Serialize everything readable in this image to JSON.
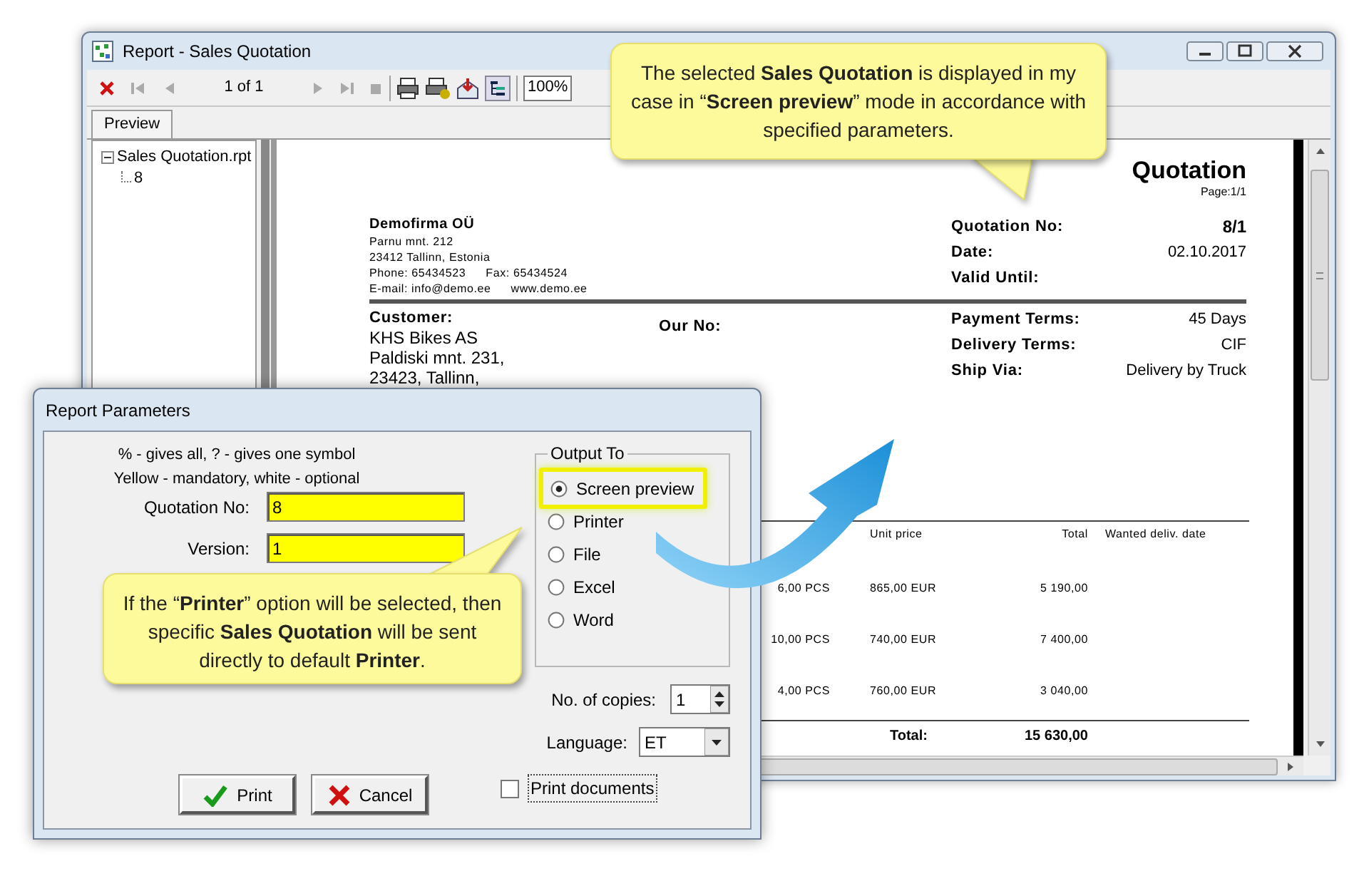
{
  "window": {
    "title": "Report - Sales Quotation",
    "toolbar": {
      "page": "1 of 1",
      "zoom": "100%"
    },
    "tabs": [
      {
        "label": "Preview",
        "selected": true
      }
    ],
    "tree": [
      {
        "label": "Sales Quotation.rpt",
        "expanded": true,
        "children": [
          {
            "label": "8"
          }
        ]
      }
    ]
  },
  "report": {
    "title": "Quotation",
    "page": "Page:1/1",
    "company": {
      "name": "Demofirma OÜ",
      "lines": [
        "Parnu mnt. 212",
        "23412 Tallinn, Estonia"
      ],
      "contacts": [
        [
          "Phone: 65434523",
          "Fax: 65434524"
        ],
        [
          "E-mail: info@demo.ee",
          "www.demo.ee"
        ]
      ]
    },
    "header_fields": [
      {
        "label": "Quotation No:",
        "value": "8/1",
        "bold": true
      },
      {
        "label": "Date:",
        "value": "02.10.2017",
        "bold": false
      },
      {
        "label": "Valid Until:"
      }
    ],
    "customer_label": "Customer:",
    "customer_lines": [
      "KHS Bikes AS",
      "Paldiski mnt. 231,",
      "23423, Tallinn,"
    ],
    "our_no_label": "Our No:",
    "terms": [
      {
        "label": "Payment Terms:",
        "value": "45 Days"
      },
      {
        "label": "Delivery Terms:",
        "value": "CIF"
      },
      {
        "label": "Ship Via:",
        "value": "Delivery by Truck"
      }
    ],
    "columns": [
      "Unit price",
      "Total",
      "Wanted deliv. date"
    ],
    "rows": [
      {
        "quantity": "6,00 PCS",
        "unit_price": "865,00 EUR",
        "total": "5 190,00"
      },
      {
        "quantity": "10,00 PCS",
        "unit_price": "740,00 EUR",
        "total": "7 400,00"
      },
      {
        "quantity": "4,00 PCS",
        "unit_price": "760,00 EUR",
        "total": "3 040,00"
      }
    ],
    "total_label": "Total:",
    "total_value": "15 630,00"
  },
  "dialog": {
    "title": "Report Parameters",
    "hints": [
      "% - gives all, ? - gives one symbol",
      "Yellow - mandatory, white - optional"
    ],
    "fields": [
      {
        "label": "Quotation No:",
        "value": "8",
        "mandatory": true
      },
      {
        "label": "Version:",
        "value": "1",
        "mandatory": true
      }
    ],
    "output_group": "Output To",
    "outputs": [
      {
        "label": "Screen preview",
        "selected": true,
        "highlighted": true
      },
      {
        "label": "Printer",
        "selected": false,
        "highlighted": false
      },
      {
        "label": "File",
        "selected": false,
        "highlighted": false
      },
      {
        "label": "Excel",
        "selected": false,
        "highlighted": false
      },
      {
        "label": "Word",
        "selected": false,
        "highlighted": false
      }
    ],
    "copies": {
      "label": "No. of copies:",
      "value": "1"
    },
    "language": {
      "label": "Language:",
      "value": "ET"
    },
    "print_documents": {
      "label": "Print documents",
      "checked": false
    },
    "buttons": [
      {
        "kind": "print",
        "label": "Print"
      },
      {
        "kind": "cancel",
        "label": "Cancel"
      }
    ]
  },
  "callouts": [
    {
      "text": "The selected **Sales Quotation** is displayed in my case in “**Screen preview**” mode in accordance with specified parameters."
    },
    {
      "text": "If the “**Printer**” option will be selected, then specific **Sales Quotation** will be sent directly to default **Printer**."
    }
  ]
}
